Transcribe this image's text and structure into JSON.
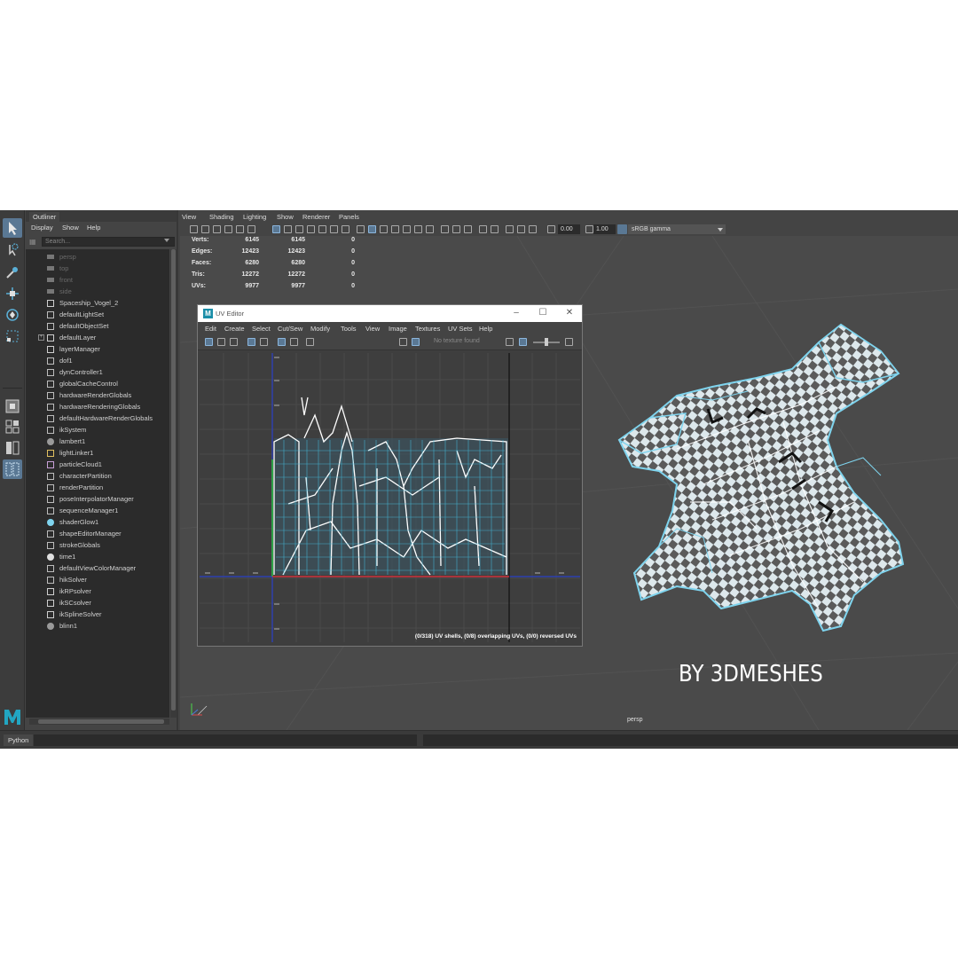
{
  "outliner": {
    "tab_label": "Outliner",
    "menu": [
      "Display",
      "Show",
      "Help"
    ],
    "search_placeholder": "Search...",
    "items": [
      {
        "label": "persp",
        "icon": "camera-icon",
        "dim": true
      },
      {
        "label": "top",
        "icon": "camera-icon",
        "dim": true
      },
      {
        "label": "front",
        "icon": "camera-icon",
        "dim": true
      },
      {
        "label": "side",
        "icon": "camera-icon",
        "dim": true
      },
      {
        "label": "Spaceship_Vogel_2",
        "icon": "transform-icon"
      },
      {
        "label": "defaultLightSet",
        "icon": "set-icon"
      },
      {
        "label": "defaultObjectSet",
        "icon": "set-icon"
      },
      {
        "label": "defaultLayer",
        "icon": "layer-icon",
        "expand": true
      },
      {
        "label": "layerManager",
        "icon": "layer-icon"
      },
      {
        "label": "dof1",
        "icon": "node-icon"
      },
      {
        "label": "dynController1",
        "icon": "node-icon"
      },
      {
        "label": "globalCacheControl",
        "icon": "node-icon"
      },
      {
        "label": "hardwareRenderGlobals",
        "icon": "node-icon"
      },
      {
        "label": "hardwareRenderingGlobals",
        "icon": "node-icon"
      },
      {
        "label": "defaultHardwareRenderGlobals",
        "icon": "node-icon"
      },
      {
        "label": "ikSystem",
        "icon": "node-icon"
      },
      {
        "label": "lambert1",
        "icon": "material-icon"
      },
      {
        "label": "lightLinker1",
        "icon": "light-icon"
      },
      {
        "label": "particleCloud1",
        "icon": "particle-icon"
      },
      {
        "label": "characterPartition",
        "icon": "node-icon"
      },
      {
        "label": "renderPartition",
        "icon": "node-icon"
      },
      {
        "label": "poseInterpolatorManager",
        "icon": "node-icon"
      },
      {
        "label": "sequenceManager1",
        "icon": "node-icon"
      },
      {
        "label": "shaderGlow1",
        "icon": "glow-icon"
      },
      {
        "label": "shapeEditorManager",
        "icon": "node-icon"
      },
      {
        "label": "strokeGlobals",
        "icon": "node-icon"
      },
      {
        "label": "time1",
        "icon": "clock-icon"
      },
      {
        "label": "defaultViewColorManager",
        "icon": "node-icon"
      },
      {
        "label": "hikSolver",
        "icon": "node-icon"
      },
      {
        "label": "ikRPsolver",
        "icon": "ik-icon"
      },
      {
        "label": "ikSCsolver",
        "icon": "ik-icon"
      },
      {
        "label": "ikSplineSolver",
        "icon": "ik-icon"
      },
      {
        "label": "blinn1",
        "icon": "material-icon"
      }
    ]
  },
  "viewport": {
    "menu": [
      "View",
      "Shading",
      "Lighting",
      "Show",
      "Renderer",
      "Panels"
    ],
    "exposure_value": "0.00",
    "gamma_value": "1.00",
    "color_space": "sRGB gamma",
    "camera_label": "persp",
    "stats": [
      {
        "label": "Verts:",
        "total": "6145",
        "selected": "6145",
        "comp": "0"
      },
      {
        "label": "Edges:",
        "total": "12423",
        "selected": "12423",
        "comp": "0"
      },
      {
        "label": "Faces:",
        "total": "6280",
        "selected": "6280",
        "comp": "0"
      },
      {
        "label": "Tris:",
        "total": "12272",
        "selected": "12272",
        "comp": "0"
      },
      {
        "label": "UVs:",
        "total": "9977",
        "selected": "9977",
        "comp": "0"
      }
    ],
    "watermark": "BY 3DMESHES"
  },
  "uv_editor": {
    "title": "UV Editor",
    "menu": [
      "Edit",
      "Create",
      "Select",
      "Cut/Sew",
      "Modify",
      "Tools",
      "View",
      "Image",
      "Textures",
      "UV Sets",
      "Help"
    ],
    "texture_status": "No texture found",
    "status": "(0/318) UV shells, (0/8) overlapping UVs, (0/0) reversed UVs"
  },
  "bottom_bar": {
    "script_label": "Python"
  },
  "colors": {
    "ui_dark": "#444444",
    "panel": "#2b2b2b",
    "accent": "#5a7894",
    "uv_cyan": "#44b8d8",
    "checker_dark": "#555555",
    "checker_light": "#d8e4e8"
  }
}
